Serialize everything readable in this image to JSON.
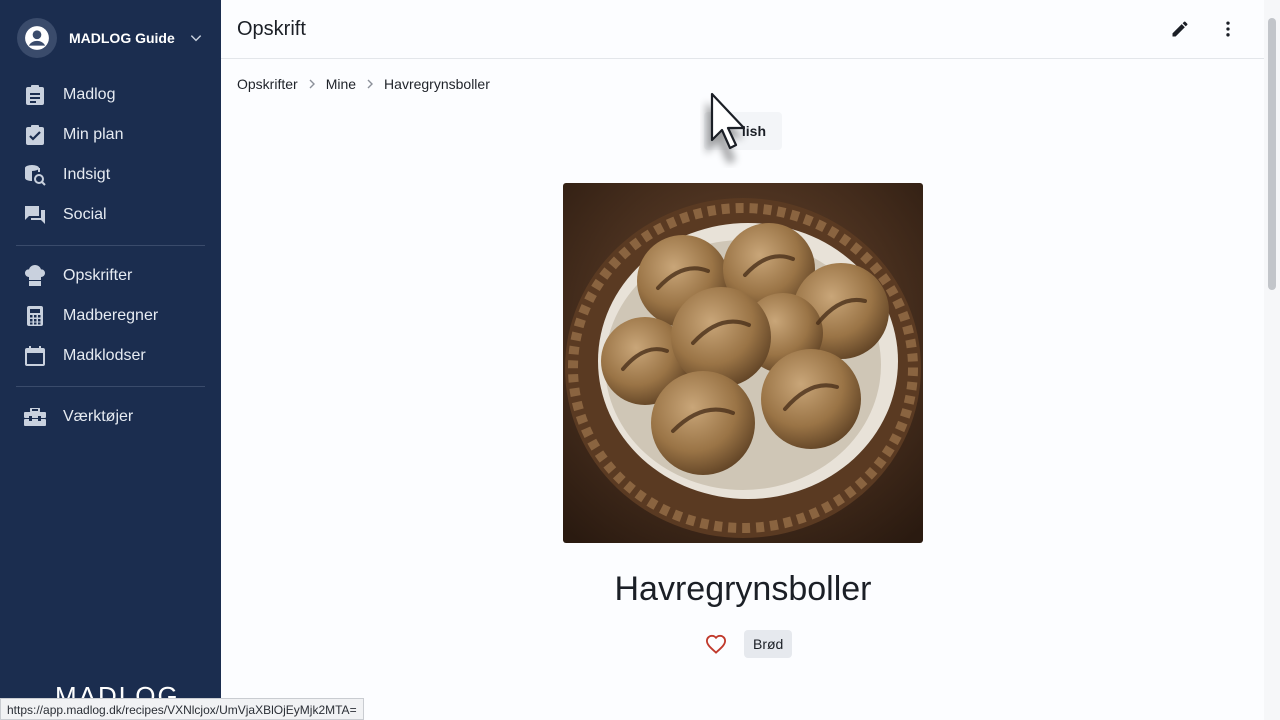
{
  "sidebar": {
    "user_name": "MADLOG Guide",
    "items": [
      {
        "label": "Madlog",
        "icon": "clipboard-icon"
      },
      {
        "label": "Min plan",
        "icon": "checklist-icon"
      },
      {
        "label": "Indsigt",
        "icon": "database-search-icon"
      },
      {
        "label": "Social",
        "icon": "chat-icon"
      },
      {
        "label": "Opskrifter",
        "icon": "chef-hat-icon"
      },
      {
        "label": "Madberegner",
        "icon": "calculator-icon"
      },
      {
        "label": "Madklodser",
        "icon": "calendar-icon"
      },
      {
        "label": "Værktøjer",
        "icon": "toolbox-icon"
      }
    ],
    "brand": "MADLOG"
  },
  "topbar": {
    "title": "Opskrift"
  },
  "breadcrumb": [
    "Opskrifter",
    "Mine",
    "Havregrynsboller"
  ],
  "language_button": "lish",
  "recipe": {
    "title": "Havregrynsboller",
    "tag": "Brød"
  },
  "status_url": "https://app.madlog.dk/recipes/VXNlcjox/UmVjaXBlOjEyMjk2MTA=",
  "colors": {
    "sidebar_bg": "#1b2d4f",
    "heart": "#c0392b"
  }
}
